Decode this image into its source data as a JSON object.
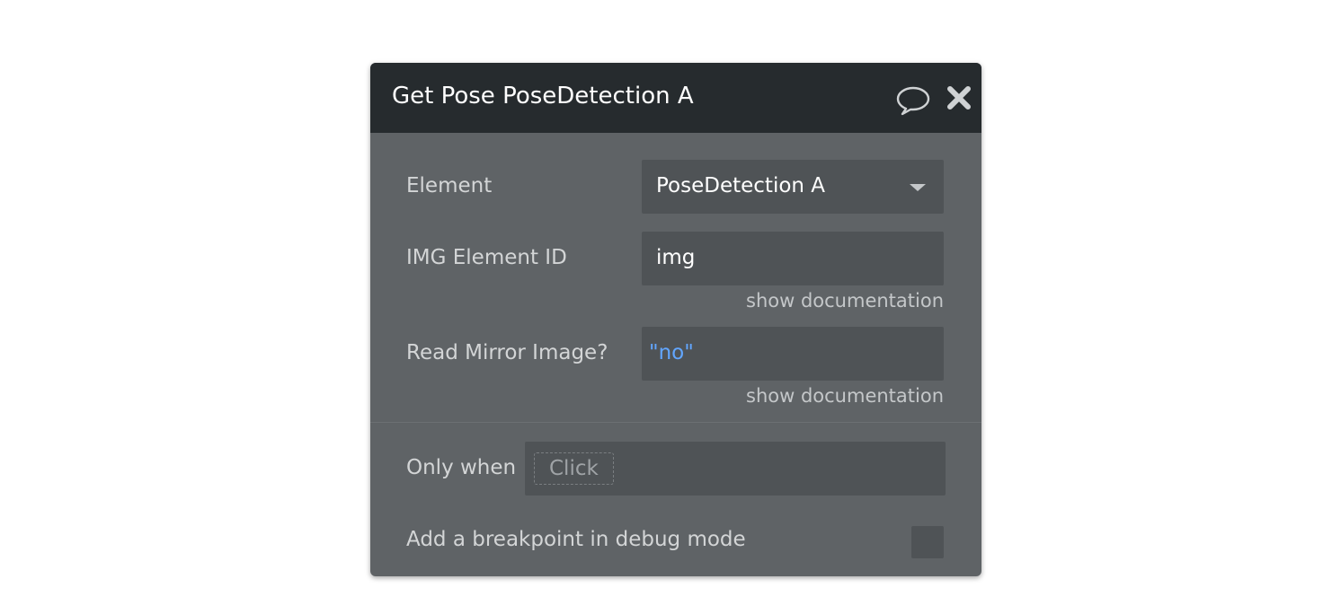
{
  "window": {
    "title": "Get Pose PoseDetection A"
  },
  "icons": {
    "comment": "comment-icon",
    "close": "close-icon",
    "dropdown": "chevron-down-icon"
  },
  "fields": {
    "element": {
      "label": "Element",
      "value": "PoseDetection A"
    },
    "img_element_id": {
      "label": "IMG Element ID",
      "value": "img",
      "doc_link": "show documentation"
    },
    "read_mirror": {
      "label": "Read Mirror Image?",
      "value": "\"no\"",
      "doc_link": "show documentation"
    }
  },
  "condition": {
    "label": "Only when",
    "placeholder": "Click"
  },
  "breakpoint": {
    "label": "Add a breakpoint in debug mode",
    "checked": false
  },
  "colors": {
    "header_bg": "#262b2e",
    "panel_bg": "#5f6366",
    "field_bg": "#4f5356",
    "expression_text": "#62a6ff"
  }
}
